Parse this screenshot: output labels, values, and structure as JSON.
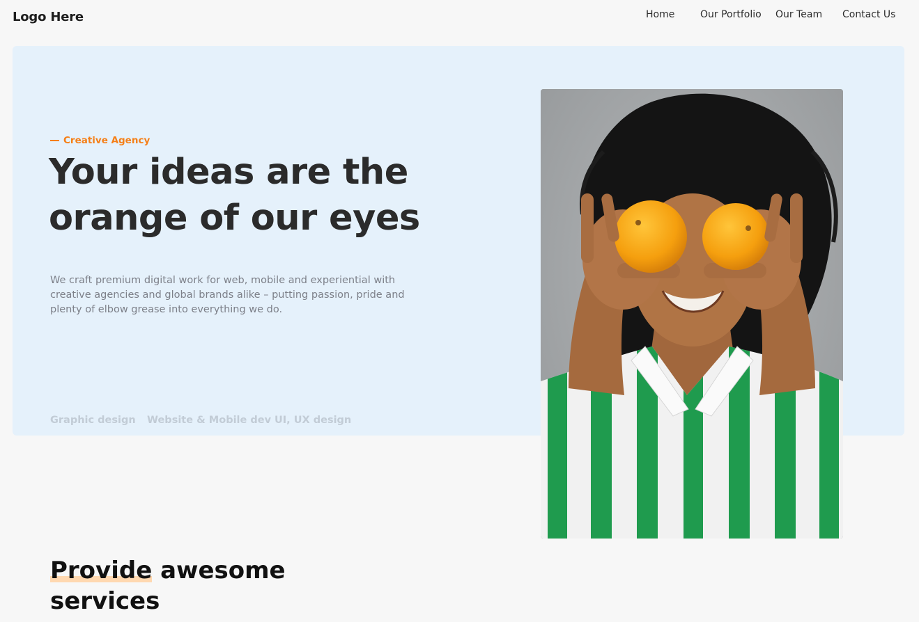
{
  "header": {
    "logo": "Logo Here",
    "nav": [
      {
        "label": "Home"
      },
      {
        "label": "Our Portfolio"
      },
      {
        "label": "Our Team"
      },
      {
        "label": "Contact Us"
      }
    ]
  },
  "hero": {
    "eyebrow": "Creative Agency",
    "title_line1": "Your ideas are the",
    "title_line2": "orange of our eyes",
    "description": "We craft premium digital work for web, mobile and experiential with creative agencies and global brands alike – putting passion, pride and plenty of elbow grease into everything we do.",
    "services": [
      "Graphic design",
      "Website & Mobile dev",
      "UI, UX design"
    ],
    "image_icon": "photo-person-holding-oranges"
  },
  "services_section": {
    "title_highlight": "Provide",
    "title_rest": " awesome",
    "title_line2": "services"
  },
  "colors": {
    "accent": "#f57f17",
    "hero_bg": "#e5f1fb",
    "page_bg": "#f7f7f7"
  }
}
